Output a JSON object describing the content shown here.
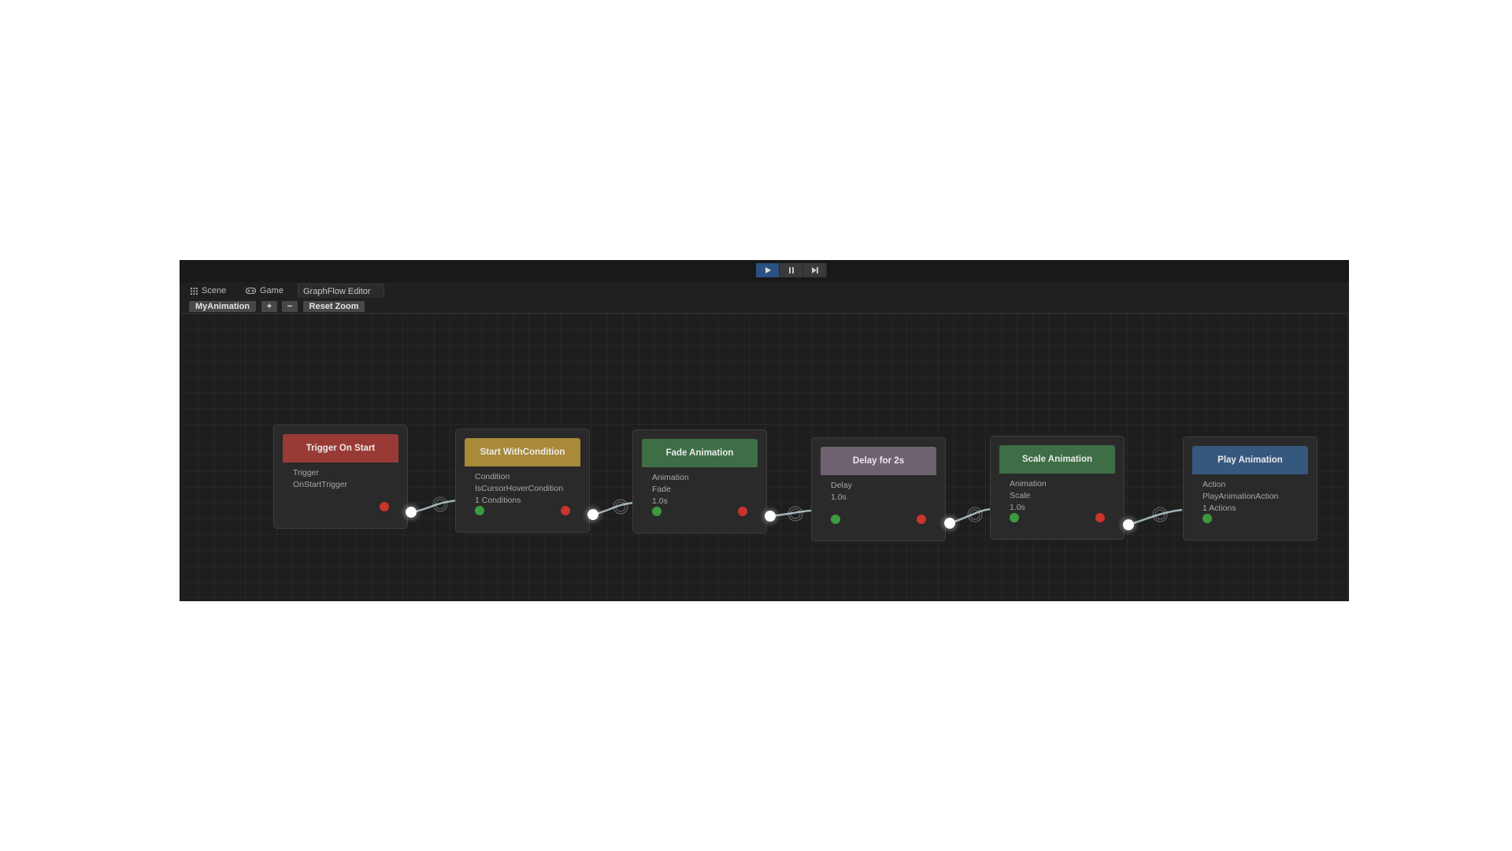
{
  "playbar": {
    "play_icon": "play-icon",
    "pause_icon": "pause-icon",
    "step_icon": "step-icon"
  },
  "tabs": [
    {
      "label": "Scene",
      "icon": "grid-icon"
    },
    {
      "label": "Game",
      "icon": "gamepad-icon"
    },
    {
      "label": "GraphFlow Editor"
    }
  ],
  "toolbar": {
    "graph_name": "MyAnimation",
    "add_label": "+",
    "remove_label": "−",
    "reset_zoom_label": "Reset Zoom"
  },
  "nodes": [
    {
      "title": "Trigger On Start",
      "color": "#9a3a36",
      "lines": [
        "Trigger",
        "OnStartTrigger",
        ""
      ]
    },
    {
      "title": "Start WithCondition",
      "color": "#a88a38",
      "lines": [
        "Condition",
        "IsCursorHoverCondition",
        "1 Conditions"
      ]
    },
    {
      "title": "Fade Animation",
      "color": "#3d6e45",
      "lines": [
        "Animation",
        "Fade",
        "1.0s"
      ]
    },
    {
      "title": "Delay for 2s",
      "color": "#6e6270",
      "lines": [
        "Delay",
        "1.0s",
        ""
      ]
    },
    {
      "title": "Scale Animation",
      "color": "#3d6e45",
      "lines": [
        "Animation",
        "Scale",
        "1.0s"
      ]
    },
    {
      "title": "Play Animation",
      "color": "#36577e",
      "lines": [
        "Action",
        "PlayAnimationAction",
        "1 Actions"
      ]
    }
  ],
  "colors": {
    "input_port": "#3e9a3e",
    "output_port": "#c9342c"
  }
}
